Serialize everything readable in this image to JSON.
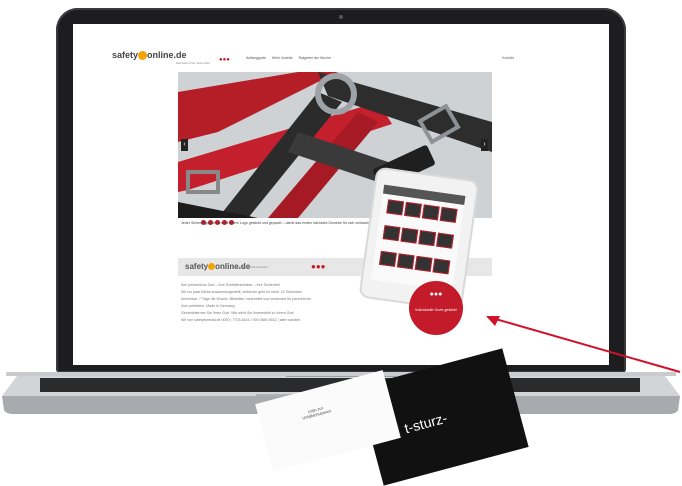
{
  "site": {
    "logo_text": "safety",
    "logo_domain": "online.de",
    "tagline": "Mehrwert Ihrer Sicherheit",
    "badge": "●●●",
    "nav": [
      "Auffanggurte",
      "Mehr Vorteile",
      "Ratgeber der Woche"
    ],
    "nav_extra": "Kontakt",
    "hero_caption": "Jeder Sicherungsgurt wird mit Ihrem Logo gestickt und gepackt – damit das ersten nächstes Gewebe für sich verkaufen",
    "band_logo_text": "safety",
    "band_logo_domain": "online.de",
    "band_tagline": "Besser Sicherheit beruflich",
    "band_badge": "●●●",
    "body_lines": [
      "Ihre persönliche Gurt – Ihre Schleifeninhaber – Ihre Sicherheit",
      "Mit nur paar Klicks zusammengestellt, einfacher geht es nicht. 10 Sekunden",
      "erreichbar. 7 Tage die Woche. Bestellen, bearbeitet und versendet für persönliche",
      "Zum perfekten. Made in Germany.",
      "Gesamthiermer Sie Ihren Gurt. Wie sieht Sie Ihrebestellt zu Ihrem Gurt",
      "Wir von safetyforestal.de 0000 | 7703-6423 / 000 0884 5532 | safe wandelt"
    ],
    "seal_text": "Individuelle Gurte gestickt"
  },
  "card": {
    "title_line1": "Logo zur",
    "title_line2": "Unfallschutzwert",
    "big_text": "t-sturz-"
  },
  "colors": {
    "accent_red": "#c31b2a",
    "brand_orange": "#f2a400",
    "bezel": "#1d1d1f"
  }
}
